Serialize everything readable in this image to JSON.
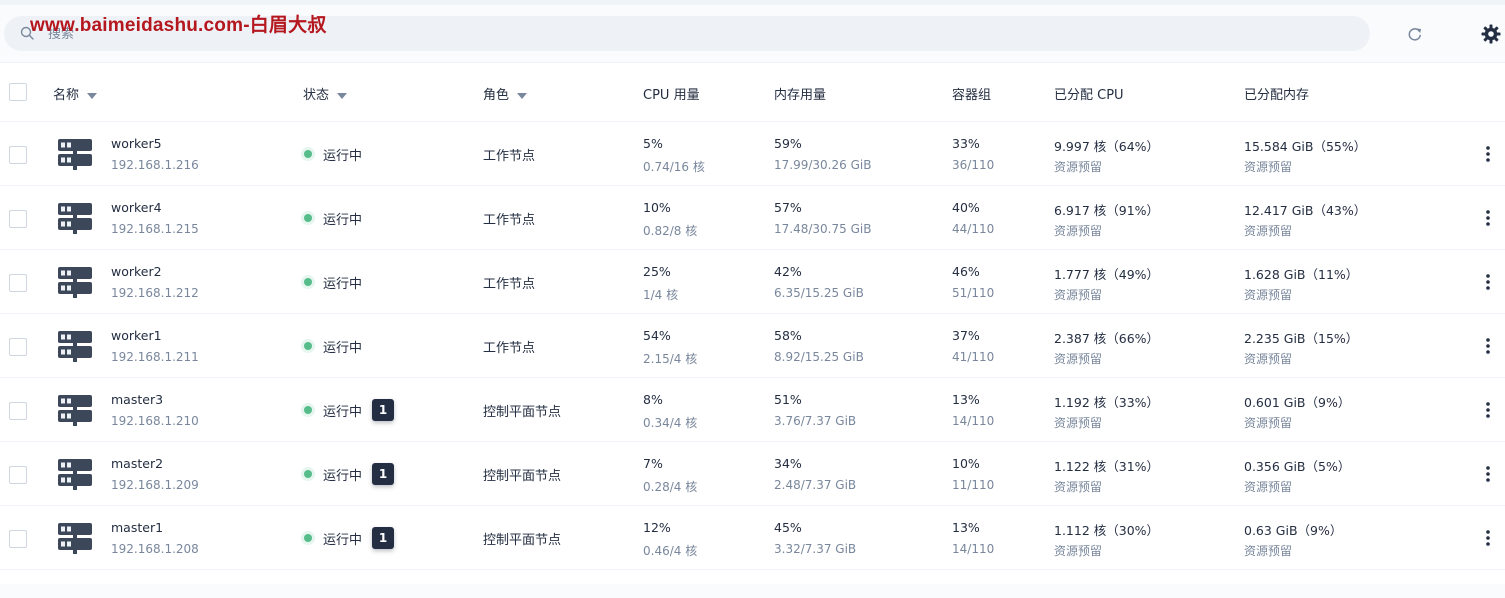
{
  "watermark": "www.baimeidashu.com-白眉大叔",
  "search": {
    "placeholder": "搜索"
  },
  "toolbar_icons": [
    "refresh-icon",
    "settings-icon"
  ],
  "columns": {
    "name": "名称",
    "status": "状态",
    "role": "角色",
    "cpu": "CPU 用量",
    "memory": "内存用量",
    "pods": "容器组",
    "alloc_cpu": "已分配 CPU",
    "alloc_mem": "已分配内存"
  },
  "rows": [
    {
      "name": "worker5",
      "ip": "192.168.1.216",
      "status": "运行中",
      "badge": "",
      "role": "工作节点",
      "cpu_pct": "5%",
      "cpu_detail": "0.74/16 核",
      "mem_pct": "59%",
      "mem_detail": "17.99/30.26 GiB",
      "pods_pct": "33%",
      "pods_detail": "36/110",
      "alloc_cpu": "9.997 核（64%）",
      "alloc_cpu_sub": "资源预留",
      "alloc_mem": "15.584 GiB（55%）",
      "alloc_mem_sub": "资源预留"
    },
    {
      "name": "worker4",
      "ip": "192.168.1.215",
      "status": "运行中",
      "badge": "",
      "role": "工作节点",
      "cpu_pct": "10%",
      "cpu_detail": "0.82/8 核",
      "mem_pct": "57%",
      "mem_detail": "17.48/30.75 GiB",
      "pods_pct": "40%",
      "pods_detail": "44/110",
      "alloc_cpu": "6.917 核（91%）",
      "alloc_cpu_sub": "资源预留",
      "alloc_mem": "12.417 GiB（43%）",
      "alloc_mem_sub": "资源预留"
    },
    {
      "name": "worker2",
      "ip": "192.168.1.212",
      "status": "运行中",
      "badge": "",
      "role": "工作节点",
      "cpu_pct": "25%",
      "cpu_detail": "1/4 核",
      "mem_pct": "42%",
      "mem_detail": "6.35/15.25 GiB",
      "pods_pct": "46%",
      "pods_detail": "51/110",
      "alloc_cpu": "1.777 核（49%）",
      "alloc_cpu_sub": "资源预留",
      "alloc_mem": "1.628 GiB（11%）",
      "alloc_mem_sub": "资源预留"
    },
    {
      "name": "worker1",
      "ip": "192.168.1.211",
      "status": "运行中",
      "badge": "",
      "role": "工作节点",
      "cpu_pct": "54%",
      "cpu_detail": "2.15/4 核",
      "mem_pct": "58%",
      "mem_detail": "8.92/15.25 GiB",
      "pods_pct": "37%",
      "pods_detail": "41/110",
      "alloc_cpu": "2.387 核（66%）",
      "alloc_cpu_sub": "资源预留",
      "alloc_mem": "2.235 GiB（15%）",
      "alloc_mem_sub": "资源预留"
    },
    {
      "name": "master3",
      "ip": "192.168.1.210",
      "status": "运行中",
      "badge": "1",
      "role": "控制平面节点",
      "cpu_pct": "8%",
      "cpu_detail": "0.34/4 核",
      "mem_pct": "51%",
      "mem_detail": "3.76/7.37 GiB",
      "pods_pct": "13%",
      "pods_detail": "14/110",
      "alloc_cpu": "1.192 核（33%）",
      "alloc_cpu_sub": "资源预留",
      "alloc_mem": "0.601 GiB（9%）",
      "alloc_mem_sub": "资源预留"
    },
    {
      "name": "master2",
      "ip": "192.168.1.209",
      "status": "运行中",
      "badge": "1",
      "role": "控制平面节点",
      "cpu_pct": "7%",
      "cpu_detail": "0.28/4 核",
      "mem_pct": "34%",
      "mem_detail": "2.48/7.37 GiB",
      "pods_pct": "10%",
      "pods_detail": "11/110",
      "alloc_cpu": "1.122 核（31%）",
      "alloc_cpu_sub": "资源预留",
      "alloc_mem": "0.356 GiB（5%）",
      "alloc_mem_sub": "资源预留"
    },
    {
      "name": "master1",
      "ip": "192.168.1.208",
      "status": "运行中",
      "badge": "1",
      "role": "控制平面节点",
      "cpu_pct": "12%",
      "cpu_detail": "0.46/4 核",
      "mem_pct": "45%",
      "mem_detail": "3.32/7.37 GiB",
      "pods_pct": "13%",
      "pods_detail": "14/110",
      "alloc_cpu": "1.112 核（30%）",
      "alloc_cpu_sub": "资源预留",
      "alloc_mem": "0.63 GiB（9%）",
      "alloc_mem_sub": "资源预留"
    }
  ],
  "colors": {
    "running": "#55bc8a",
    "text": "#242e42",
    "muted": "#79879c",
    "watermark": "#b5171f"
  }
}
